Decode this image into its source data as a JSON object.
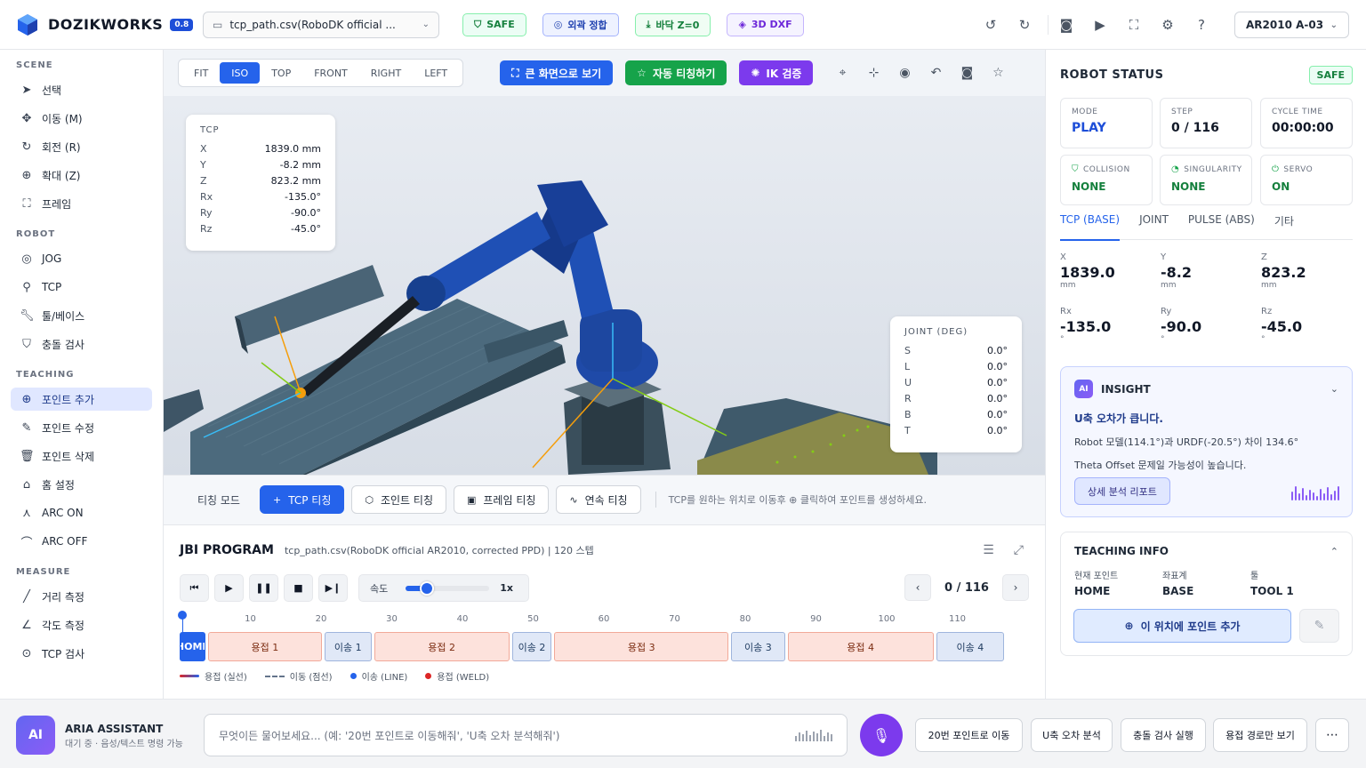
{
  "app": {
    "name": "DOZIKWORKS",
    "version": "0.8"
  },
  "header": {
    "file": "tcp_path.csv(RoboDK official ...",
    "badges": [
      {
        "label": "SAFE",
        "icon": "shield-icon"
      },
      {
        "label": "외곽 정합",
        "icon": "target-icon"
      },
      {
        "label": "바닥 Z=0",
        "icon": "floor-icon"
      },
      {
        "label": "3D DXF",
        "icon": "layers-icon"
      }
    ],
    "robot": "AR2010 A-03"
  },
  "sidebar": {
    "sections": {
      "scene": "SCENE",
      "robot": "ROBOT",
      "teaching": "TEACHING",
      "measure": "MEASURE"
    },
    "scene": [
      "선택",
      "이동 (M)",
      "회전 (R)",
      "확대 (Z)",
      "프레임"
    ],
    "robot": [
      "JOG",
      "TCP",
      "툴/베이스",
      "충돌 검사"
    ],
    "teaching": [
      "포인트 추가",
      "포인트 수정",
      "포인트 삭제",
      "홈 설정",
      "ARC ON",
      "ARC OFF"
    ],
    "measure": [
      "거리 측정",
      "각도 측정",
      "TCP 검사"
    ]
  },
  "viewport": {
    "views": [
      "FIT",
      "ISO",
      "TOP",
      "FRONT",
      "RIGHT",
      "LEFT"
    ],
    "active_view": "ISO",
    "fullscreen": "큰 화면으로 보기",
    "auto_teach": "자동 티칭하기",
    "ik_check": "IK 검증",
    "tcp_panel": {
      "title": "TCP",
      "rows": [
        {
          "k": "X",
          "v": "1839.0 mm"
        },
        {
          "k": "Y",
          "v": "-8.2 mm"
        },
        {
          "k": "Z",
          "v": "823.2 mm"
        },
        {
          "k": "Rx",
          "v": "-135.0°"
        },
        {
          "k": "Ry",
          "v": "-90.0°"
        },
        {
          "k": "Rz",
          "v": "-45.0°"
        }
      ]
    },
    "joint_panel": {
      "title": "JOINT (DEG)",
      "rows": [
        {
          "k": "S",
          "v": "0.0°"
        },
        {
          "k": "L",
          "v": "0.0°"
        },
        {
          "k": "U",
          "v": "0.0°"
        },
        {
          "k": "R",
          "v": "0.0°"
        },
        {
          "k": "B",
          "v": "0.0°"
        },
        {
          "k": "T",
          "v": "0.0°"
        }
      ]
    }
  },
  "teach": {
    "label": "티칭 모드",
    "modes": [
      "TCP 티칭",
      "조인트 티칭",
      "프레임 티칭",
      "연속 티칭"
    ],
    "active": "TCP 티칭",
    "hint": "TCP를 원하는 위치로 이동후 ⊕ 클릭하여 포인트를 생성하세요."
  },
  "jbi": {
    "title": "JBI PROGRAM",
    "subtitle": "tcp_path.csv(RoboDK official AR2010, corrected PPD) | 120 스텝",
    "speed_label": "속도",
    "speed_value": "1x",
    "speed_fraction": 0.25,
    "step": "0 / 116",
    "total_steps": 120,
    "ticks": [
      10,
      20,
      30,
      40,
      50,
      60,
      70,
      80,
      90,
      100,
      110
    ],
    "segments": [
      {
        "label": "HOME",
        "type": "home",
        "start": 0,
        "end": 4
      },
      {
        "label": "용접 1",
        "type": "weld",
        "start": 4,
        "end": 20.5
      },
      {
        "label": "이송 1",
        "type": "move",
        "start": 20.5,
        "end": 27.5
      },
      {
        "label": "용접 2",
        "type": "weld",
        "start": 27.5,
        "end": 47
      },
      {
        "label": "이송 2",
        "type": "move",
        "start": 47,
        "end": 53
      },
      {
        "label": "용접 3",
        "type": "weld",
        "start": 53,
        "end": 78
      },
      {
        "label": "이송 3",
        "type": "move",
        "start": 78,
        "end": 86
      },
      {
        "label": "용접 4",
        "type": "weld",
        "start": 86,
        "end": 107
      },
      {
        "label": "이송 4",
        "type": "move",
        "start": 107,
        "end": 117
      }
    ],
    "legend": [
      "용접 (실선)",
      "이동 (점선)",
      "이송 (LINE)",
      "용접 (WELD)"
    ]
  },
  "status": {
    "title": "ROBOT STATUS",
    "safe": "SAFE",
    "cards": [
      {
        "label": "MODE",
        "value": "PLAY"
      },
      {
        "label": "STEP",
        "value": "0 / 116"
      },
      {
        "label": "CYCLE TIME",
        "value": "00:00:00"
      },
      {
        "label": "COLLISION",
        "value": "NONE",
        "icon": "shield-icon"
      },
      {
        "label": "SINGULARITY",
        "value": "NONE",
        "icon": "check-circle-icon"
      },
      {
        "label": "SERVO",
        "value": "ON",
        "icon": "power-icon"
      }
    ],
    "tabs": [
      "TCP (BASE)",
      "JOINT",
      "PULSE (ABS)",
      "기타"
    ],
    "coords": [
      {
        "k": "X",
        "v": "1839.0",
        "u": "mm"
      },
      {
        "k": "Y",
        "v": "-8.2",
        "u": "mm"
      },
      {
        "k": "Z",
        "v": "823.2",
        "u": "mm"
      },
      {
        "k": "Rx",
        "v": "-135.0",
        "u": "°"
      },
      {
        "k": "Ry",
        "v": "-90.0",
        "u": "°"
      },
      {
        "k": "Rz",
        "v": "-45.0",
        "u": "°"
      }
    ]
  },
  "insight": {
    "badge": "AI",
    "title": "INSIGHT",
    "main": "U축 오차가 큽니다.",
    "line1": "Robot 모델(114.1°)과 URDF(-20.5°) 차이 134.6°",
    "line2": "Theta Offset 문제일 가능성이 높습니다.",
    "button": "상세 분석 리포트"
  },
  "teaching_info": {
    "title": "TEACHING INFO",
    "cols": [
      {
        "k": "현재 포인트",
        "v": "HOME"
      },
      {
        "k": "좌표계",
        "v": "BASE"
      },
      {
        "k": "툴",
        "v": "TOOL 1"
      }
    ],
    "add": "이 위치에 포인트 추가"
  },
  "assistant": {
    "avatar": "AI",
    "name": "ARIA ASSISTANT",
    "status": "대기 중 · 음성/텍스트 명령 가능",
    "placeholder": "무엇이든 물어보세요... (예: '20번 포인트로 이동해줘', 'U축 오차 분석해줘')",
    "quick": [
      "20번 포인트로 이동",
      "U축 오차 분석",
      "충돌 검사 실행",
      "용접 경로만 보기",
      "⋯"
    ]
  }
}
